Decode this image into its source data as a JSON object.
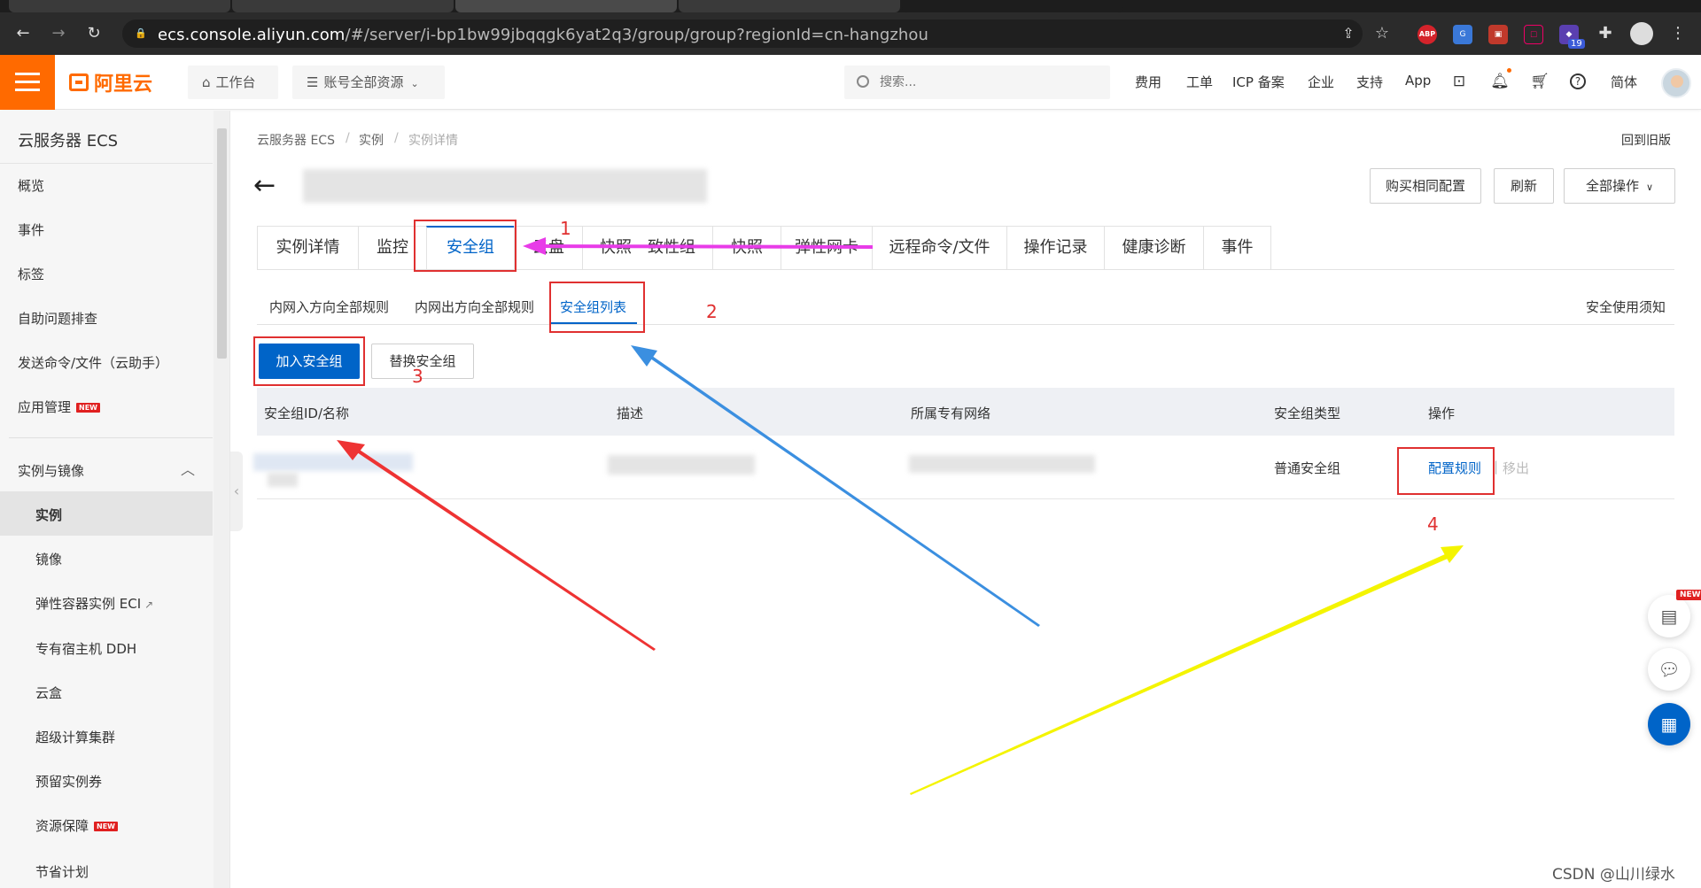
{
  "browser": {
    "url_host": "ecs.console.aliyun.com",
    "url_rest": "/#/server/i-bp1bw99jbqqgk6yat2q3/group/group?regionId=cn-hangzhou",
    "extension_badge": "19",
    "abp_label": "ABP"
  },
  "topbar": {
    "logo_text": "阿里云",
    "workbench": "工作台",
    "resources": "账号全部资源",
    "search_placeholder": "搜索...",
    "links": [
      "费用",
      "工单",
      "ICP 备案",
      "企业",
      "支持",
      "App"
    ],
    "lang": "简体"
  },
  "sidebar": {
    "title": "云服务器 ECS",
    "items": [
      "概览",
      "事件",
      "标签",
      "自助问题排查",
      "发送命令/文件（云助手）",
      "应用管理"
    ],
    "new_badge": "NEW",
    "group_title": "实例与镜像",
    "sub_items": [
      "实例",
      "镜像",
      "弹性容器实例 ECI",
      "专有宿主机 DDH",
      "云盒",
      "超级计算集群",
      "预留实例券",
      "资源保障",
      "节省计划"
    ]
  },
  "breadcrumb": {
    "items": [
      "云服务器 ECS",
      "实例",
      "实例详情"
    ],
    "sep": "/"
  },
  "header": {
    "old_version": "回到旧版",
    "buy_same": "购买相同配置",
    "refresh": "刷新",
    "all_actions": "全部操作"
  },
  "tabs": [
    "实例详情",
    "监控",
    "安全组",
    "云盘",
    "快照一致性组",
    "快照",
    "弹性网卡",
    "远程命令/文件",
    "操作记录",
    "健康诊断",
    "事件"
  ],
  "subtabs": [
    "内网入方向全部规则",
    "内网出方向全部规则",
    "安全组列表"
  ],
  "notice_link": "安全使用须知",
  "actions": {
    "join": "加入安全组",
    "replace": "替换安全组"
  },
  "table": {
    "headers": [
      "安全组ID/名称",
      "描述",
      "所属专有网络",
      "安全组类型",
      "操作"
    ],
    "rows": [
      {
        "type": "普通安全组",
        "action_config": "配置规则",
        "action_remove": "移出",
        "separator": "|"
      }
    ]
  },
  "annotations": [
    "1",
    "2",
    "3",
    "4"
  ],
  "watermark": "CSDN @山川绿水",
  "colors": {
    "accent": "#0064c8",
    "brand": "#ff6a00",
    "annotation_red": "#e03030",
    "arrow_magenta": "#e83ce8",
    "arrow_blue": "#3b8fe0",
    "arrow_yellow": "#f4f400"
  }
}
